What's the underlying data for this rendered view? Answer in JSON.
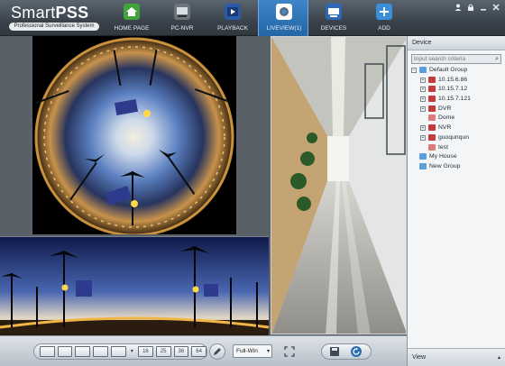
{
  "app": {
    "title_light": "Smart",
    "title_bold": "PSS",
    "subtitle": "Professional Surveillance System"
  },
  "nav": {
    "items": [
      {
        "label": "HOME PAGE",
        "icon": "home-icon",
        "color": "#3fa53a"
      },
      {
        "label": "PC-NVR",
        "icon": "pc-nvr-icon",
        "color": "#6d747b"
      },
      {
        "label": "PLAYBACK",
        "icon": "playback-icon",
        "color": "#2b5aa8"
      },
      {
        "label": "LIVEVIEW(1)",
        "icon": "liveview-icon",
        "color": "#3b8fd6"
      },
      {
        "label": "DEVICES",
        "icon": "devices-icon",
        "color": "#2d69b7"
      },
      {
        "label": "ADD",
        "icon": "add-icon",
        "color": "#3a8fd8"
      }
    ],
    "active": "LIVEVIEW(1)"
  },
  "window_controls": [
    "user-icon",
    "lock-icon",
    "minimize-icon",
    "close-icon"
  ],
  "sidebar": {
    "header": "Device",
    "search_placeholder": "Input search criteria",
    "tree": [
      {
        "label": "Default Group",
        "type": "group",
        "level": 0
      },
      {
        "label": "10.15.6.86",
        "type": "device",
        "level": 1
      },
      {
        "label": "10.15.7.12",
        "type": "device",
        "level": 1
      },
      {
        "label": "10.15.7.121",
        "type": "device",
        "level": 1
      },
      {
        "label": "DVR",
        "type": "device",
        "level": 1
      },
      {
        "label": "Dome",
        "type": "device-offline",
        "level": 1
      },
      {
        "label": "NVR",
        "type": "device",
        "level": 1
      },
      {
        "label": "guoqunqun",
        "type": "device",
        "level": 1
      },
      {
        "label": "test",
        "type": "device-offline",
        "level": 1
      },
      {
        "label": "My House",
        "type": "group",
        "level": 0
      },
      {
        "label": "New Group",
        "type": "group",
        "level": 0
      }
    ],
    "footer": "View"
  },
  "bottom_toolbar": {
    "layouts": [
      "1",
      "4",
      "6",
      "8",
      "9",
      "16",
      "25",
      "36",
      "64"
    ],
    "display_mode": "Full-Win",
    "icons": [
      "pencil-icon",
      "fullscreen-icon",
      "save-icon",
      "refresh-icon"
    ]
  },
  "colors": {
    "accent": "#2a6db3",
    "topbar": "#3a434c"
  }
}
